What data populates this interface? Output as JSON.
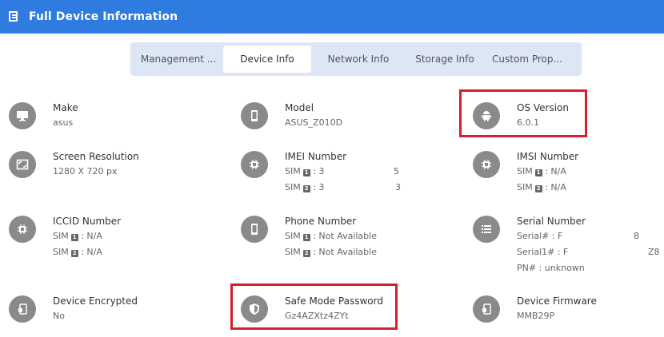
{
  "header": {
    "title": "Full Device Information",
    "icon": "document-icon"
  },
  "tabs": [
    "Management ...",
    "Device Info",
    "Network Info",
    "Storage Info",
    "Custom Prop..."
  ],
  "fields": {
    "make": {
      "label": "Make",
      "value": "asus"
    },
    "model": {
      "label": "Model",
      "value": "ASUS_Z010D"
    },
    "os": {
      "label": "OS Version",
      "value": "6.0.1"
    },
    "screen": {
      "label": "Screen Resolution",
      "value": "1280 X 720 px"
    },
    "imei": {
      "label": "IMEI Number",
      "sim1_prefix": "SIM",
      "sim1_num": "1",
      "sim1_value": ": 3",
      "sim1_tail": "5",
      "sim2_prefix": "SIM",
      "sim2_num": "2",
      "sim2_value": ": 3",
      "sim2_tail": "3"
    },
    "imsi": {
      "label": "IMSI Number",
      "sim1_prefix": "SIM",
      "sim1_num": "1",
      "sim1_value": ": N/A",
      "sim2_prefix": "SIM",
      "sim2_num": "2",
      "sim2_value": ": N/A"
    },
    "iccid": {
      "label": "ICCID Number",
      "sim1_prefix": "SIM",
      "sim1_num": "1",
      "sim1_value": ": N/A",
      "sim2_prefix": "SIM",
      "sim2_num": "2",
      "sim2_value": ": N/A"
    },
    "phone": {
      "label": "Phone Number",
      "sim1_prefix": "SIM",
      "sim1_num": "1",
      "sim1_value": ": Not Available",
      "sim2_prefix": "SIM",
      "sim2_num": "2",
      "sim2_value": ": Not Available"
    },
    "serial": {
      "label": "Serial Number",
      "line1": "Serial# : F",
      "line1_tail": "8",
      "line2": "Serial1# : F",
      "line2_tail": "Z8",
      "line3": "PN# : unknown"
    },
    "encrypted": {
      "label": "Device Encrypted",
      "value": "No"
    },
    "safemode": {
      "label": "Safe Mode Password",
      "value": "Gz4AZXtz4ZYt"
    },
    "firmware": {
      "label": "Device Firmware",
      "value": "MMB29P"
    }
  },
  "colors": {
    "header": "#2f7be0",
    "tabs_bg": "#dde6f5",
    "icon_circle": "#8a8a8a",
    "highlight": "#d71f2b"
  }
}
